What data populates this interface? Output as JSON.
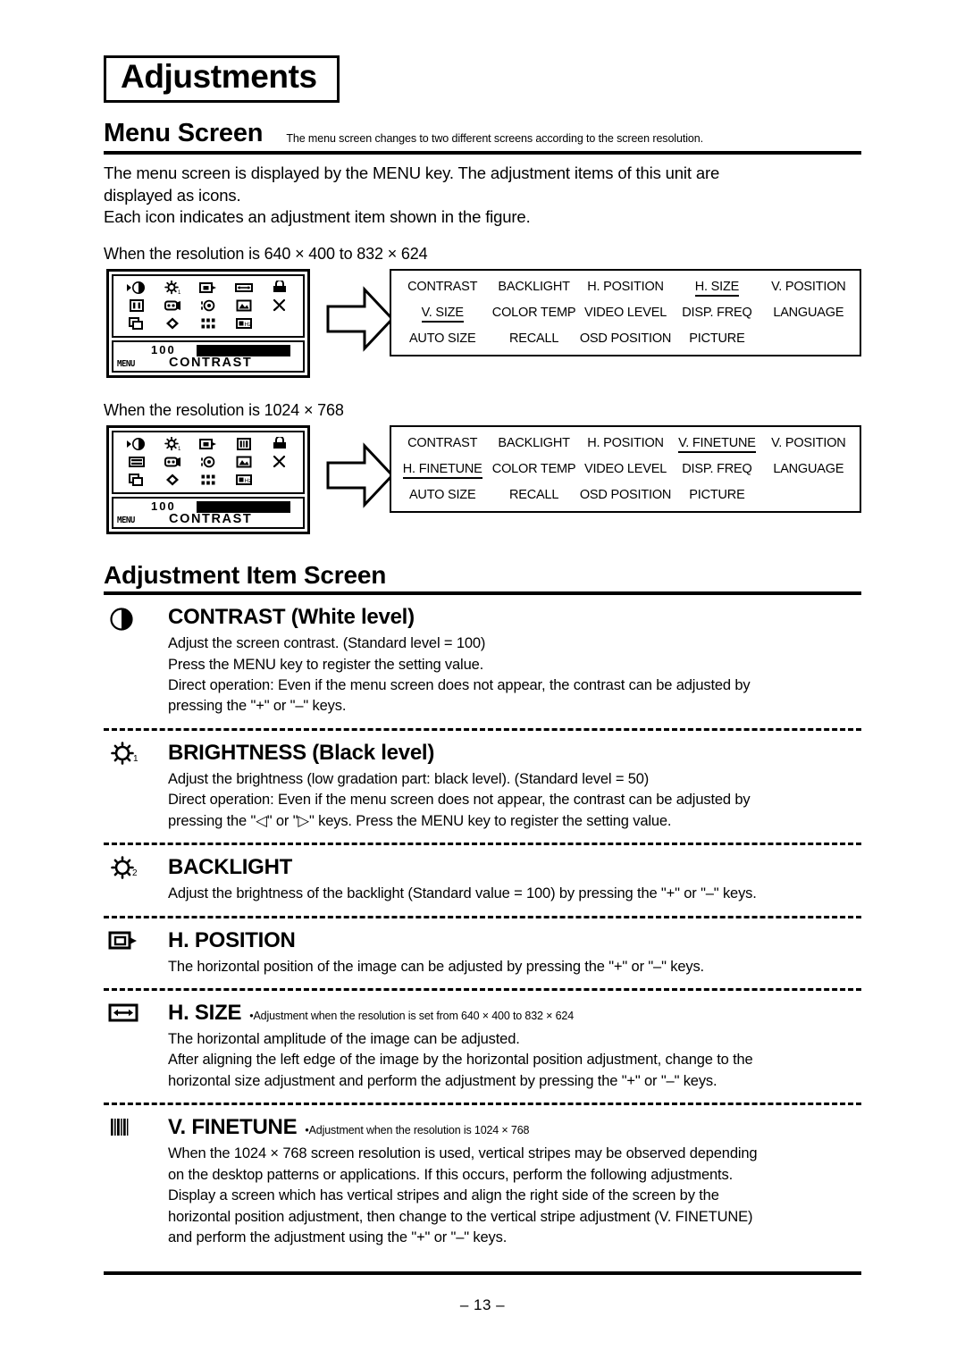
{
  "document": {
    "title": "Adjustments",
    "page_number": "– 13 –"
  },
  "menu_screen": {
    "heading": "Menu Screen",
    "note": "The menu screen changes to two different screens according to the screen resolution.",
    "paragraph1": "The menu screen is displayed by the MENU key. The adjustment items of this unit are",
    "paragraph2": "displayed as icons.",
    "paragraph3": "Each icon indicates an adjustment item shown in the figure."
  },
  "diagrams": [
    {
      "caption": "When the resolution is 640 × 400 to 832 × 624",
      "osd": {
        "value": "100",
        "menu_key": "MENU",
        "item_label": "CONTRAST"
      },
      "labels": [
        [
          {
            "text": "CONTRAST",
            "underline": false
          },
          {
            "text": "BACKLIGHT",
            "underline": false
          },
          {
            "text": "H. POSITION",
            "underline": false
          },
          {
            "text": "H. SIZE",
            "underline": true
          },
          {
            "text": "V. POSITION",
            "underline": false
          }
        ],
        [
          {
            "text": "V. SIZE",
            "underline": true
          },
          {
            "text": "COLOR TEMP",
            "underline": false
          },
          {
            "text": "VIDEO LEVEL",
            "underline": false
          },
          {
            "text": "DISP. FREQ",
            "underline": false
          },
          {
            "text": "LANGUAGE",
            "underline": false
          }
        ],
        [
          {
            "text": "AUTO SIZE",
            "underline": false
          },
          {
            "text": "RECALL",
            "underline": false
          },
          {
            "text": "OSD POSITION",
            "underline": false
          },
          {
            "text": "PICTURE",
            "underline": false
          },
          {
            "text": "",
            "underline": false
          }
        ]
      ]
    },
    {
      "caption": "When the resolution is 1024 × 768",
      "osd": {
        "value": "100",
        "menu_key": "MENU",
        "item_label": "CONTRAST"
      },
      "labels": [
        [
          {
            "text": "CONTRAST",
            "underline": false
          },
          {
            "text": "BACKLIGHT",
            "underline": false
          },
          {
            "text": "H. POSITION",
            "underline": false
          },
          {
            "text": "V. FINETUNE",
            "underline": true
          },
          {
            "text": "V. POSITION",
            "underline": false
          }
        ],
        [
          {
            "text": "H. FINETUNE",
            "underline": true
          },
          {
            "text": "COLOR TEMP",
            "underline": false
          },
          {
            "text": "VIDEO LEVEL",
            "underline": false
          },
          {
            "text": "DISP. FREQ",
            "underline": false
          },
          {
            "text": "LANGUAGE",
            "underline": false
          }
        ],
        [
          {
            "text": "AUTO SIZE",
            "underline": false
          },
          {
            "text": "RECALL",
            "underline": false
          },
          {
            "text": "OSD POSITION",
            "underline": false
          },
          {
            "text": "PICTURE",
            "underline": false
          },
          {
            "text": "",
            "underline": false
          }
        ]
      ]
    }
  ],
  "adjustment_item_screen": {
    "heading": "Adjustment Item Screen",
    "items": [
      {
        "icon": "contrast-half-circle-icon",
        "title": "CONTRAST (White level)",
        "note": "",
        "lines": [
          "Adjust the screen contrast. (Standard level = 100)",
          "Press the MENU key to register the setting value.",
          "Direct operation: Even if the menu screen does not appear, the contrast can be adjusted by",
          "pressing the \"+\" or \"–\" keys."
        ]
      },
      {
        "icon": "brightness-sun-1-icon",
        "title": "BRIGHTNESS (Black level)",
        "note": "",
        "lines": [
          "Adjust the brightness (low gradation part: black level). (Standard level = 50)",
          "Direct operation: Even if the menu screen does not appear, the contrast can be adjusted by",
          "pressing the \"◁\" or \"▷\" keys. Press the MENU key to register the setting value."
        ]
      },
      {
        "icon": "brightness-sun-2-icon",
        "title": "BACKLIGHT",
        "note": "",
        "lines": [
          "Adjust the brightness of the backlight (Standard value = 100) by pressing the \"+\" or \"–\" keys."
        ]
      },
      {
        "icon": "h-position-icon",
        "title": "H. POSITION",
        "note": "",
        "lines": [
          "The horizontal position of the image can be adjusted by pressing the \"+\" or \"–\" keys."
        ]
      },
      {
        "icon": "h-size-arrow-icon",
        "title": "H. SIZE",
        "note": "•Adjustment when the resolution is set from 640 × 400 to 832 × 624",
        "lines": [
          "The horizontal amplitude of the image can be adjusted.",
          "After aligning the left edge of the image by the horizontal position adjustment, change to the",
          "horizontal size adjustment and perform the adjustment by pressing the \"+\" or \"–\" keys."
        ]
      },
      {
        "icon": "v-finetune-stripes-icon",
        "title": "V. FINETUNE",
        "note": "•Adjustment when the resolution is 1024 × 768",
        "lines": [
          "When the 1024 × 768 screen resolution is used, vertical stripes may be observed depending",
          "on the desktop patterns or applications. If this occurs, perform the following adjustments.",
          "Display a screen which has vertical stripes and align the right side of the screen by the",
          "horizontal position adjustment, then change to the vertical stripe adjustment (V. FINETUNE)",
          "and perform the adjustment using the \"+\" or \"–\" keys."
        ]
      }
    ]
  }
}
